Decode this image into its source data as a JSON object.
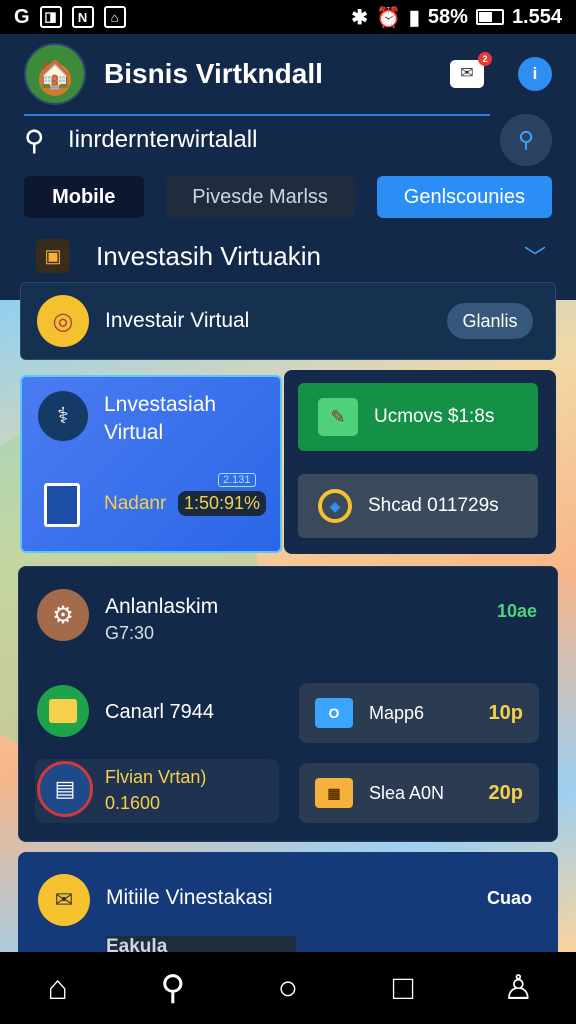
{
  "status": {
    "left_icons": [
      "G",
      "◨",
      "N",
      "⌂"
    ],
    "battery": "58%",
    "time": "1.554"
  },
  "header": {
    "title": "Bisnis Virtkndall",
    "msg_badge": "2"
  },
  "search": {
    "value": "Iinrdernterwirtalall"
  },
  "tabs": [
    "Mobile",
    "Pivesde Marlss",
    "Genlscounies"
  ],
  "section": {
    "title": "Investasih Virtuakin"
  },
  "card_top": {
    "label": "Investair Virtual",
    "pill": "Glanlis"
  },
  "card_blue": {
    "title": "Lnvestasiah Virtual",
    "label": "Nadanr",
    "badge": "1:50:91%",
    "mini": "2.131"
  },
  "card_green": {
    "label": "Ucmovs $1:8s"
  },
  "card_grey": {
    "label": "Shcad 011729s"
  },
  "panel": {
    "row1": {
      "title": "Anlanlaskim",
      "sub": "G7:30",
      "value": "10ae"
    },
    "row2": {
      "title": "Canarl 7944"
    },
    "row3": {
      "title": "Flvian Vrtan)",
      "sub": "0.1600"
    },
    "small1": {
      "icon": "O",
      "label": "Mapp6",
      "value": "10p"
    },
    "small2": {
      "icon": "▦",
      "label": "Slea A0N",
      "value": "20p"
    }
  },
  "panel2": {
    "title": "Mitiile Vinestakasi",
    "value": "Cuao",
    "sub": "Eakula"
  },
  "colors": {
    "accent": "#2b8ef4",
    "green": "#149146",
    "yellow": "#f4c22f"
  }
}
